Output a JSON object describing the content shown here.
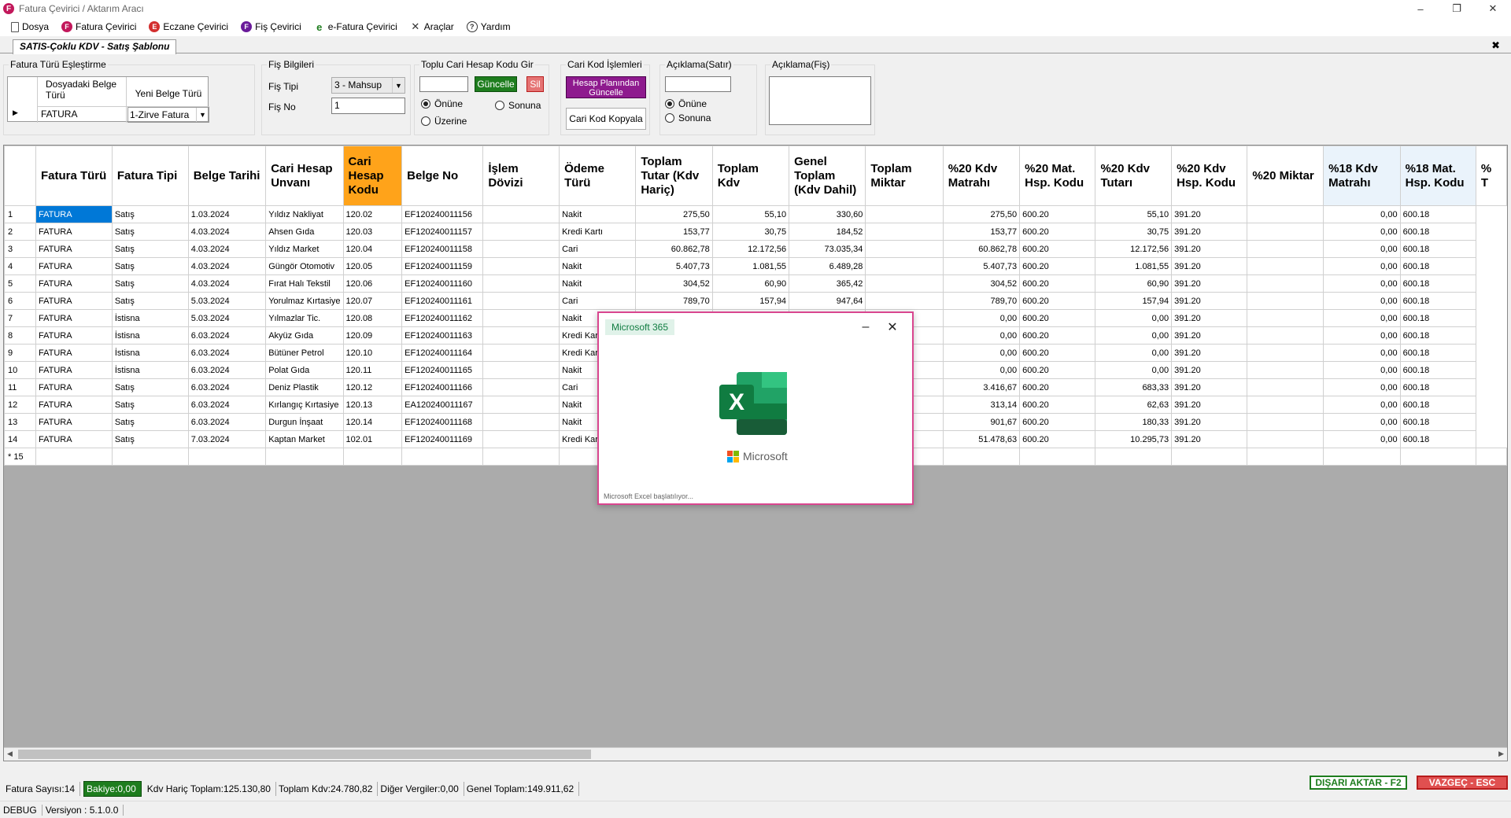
{
  "window": {
    "title": "Fatura Çevirici / Aktarım Aracı",
    "logo_letter": "F"
  },
  "menu": [
    {
      "label": "Dosya",
      "icon": "document-icon",
      "letter": ""
    },
    {
      "label": "Fatura Çevirici",
      "icon": "fatura-logo-icon",
      "letter": "F"
    },
    {
      "label": "Eczane Çevirici",
      "icon": "eczane-logo-icon",
      "letter": "E"
    },
    {
      "label": "Fiş Çevirici",
      "icon": "fis-logo-icon",
      "letter": "F"
    },
    {
      "label": "e-Fatura Çevirici",
      "icon": "efatura-icon",
      "letter": "e"
    },
    {
      "label": "Araçlar",
      "icon": "tools-icon",
      "letter": "✕"
    },
    {
      "label": "Yardım",
      "icon": "help-icon",
      "letter": "?"
    }
  ],
  "tab": {
    "label": "SATIS-Çoklu KDV - Satış Şablonu"
  },
  "fatura_turu": {
    "title": "Fatura Türü Eşleştirme",
    "col1": "Dosyadaki Belge Türü",
    "col2": "Yeni Belge Türü",
    "row_value": "FATURA",
    "new_type": "1-Zirve Fatura"
  },
  "fis_bilgileri": {
    "title": "Fiş Bilgileri",
    "fis_tipi_label": "Fiş Tipi",
    "fis_tipi_value": "3 - Mahsup",
    "fis_no_label": "Fiş No",
    "fis_no_value": "1"
  },
  "toplu_cari": {
    "title": "Toplu Cari Hesap Kodu Gir",
    "input_value": "",
    "update_label": "Güncelle",
    "delete_label": "Sil",
    "radio_onune": "Önüne",
    "radio_sonuna": "Sonuna",
    "radio_uzerine": "Üzerine"
  },
  "cari_kod": {
    "title": "Cari Kod İşlemleri",
    "update_plan_label": "Hesap Planından Güncelle",
    "copy_label": "Cari Kod Kopyala"
  },
  "aciklama_satir": {
    "title": "Açıklama(Satır)",
    "value": "",
    "radio_onune": "Önüne",
    "radio_sonuna": "Sonuna"
  },
  "aciklama_fis": {
    "title": "Açıklama(Fiş)",
    "value": ""
  },
  "grid": {
    "headers": [
      "Fatura Türü",
      "Fatura Tipi",
      "Belge Tarihi",
      "Cari Hesap Unvanı",
      "Cari Hesap Kodu",
      "Belge No",
      "İşlem Dövizi",
      "Ödeme Türü",
      "Toplam Tutar (Kdv Hariç)",
      "Toplam Kdv",
      "Genel Toplam (Kdv Dahil)",
      "Toplam Miktar",
      "%20 Kdv Matrahı",
      "%20 Mat. Hsp. Kodu",
      "%20 Kdv Tutarı",
      "%20 Kdv Hsp. Kodu",
      "%20 Miktar",
      "%18 Kdv Matrahı",
      "%18 Mat. Hsp. Kodu",
      "% T"
    ],
    "rows": [
      [
        "1",
        "FATURA",
        "Satış",
        "1.03.2024",
        "Yıldız Nakliyat",
        "120.02",
        "EF120240011156",
        "",
        "Nakit",
        "275,50",
        "55,10",
        "330,60",
        "",
        "275,50",
        "600.20",
        "55,10",
        "391.20",
        "",
        "0,00",
        "600.18"
      ],
      [
        "2",
        "FATURA",
        "Satış",
        "4.03.2024",
        "Ahsen Gıda",
        "120.03",
        "EF120240011157",
        "",
        "Kredi Kartı",
        "153,77",
        "30,75",
        "184,52",
        "",
        "153,77",
        "600.20",
        "30,75",
        "391.20",
        "",
        "0,00",
        "600.18"
      ],
      [
        "3",
        "FATURA",
        "Satış",
        "4.03.2024",
        "Yıldız Market",
        "120.04",
        "EF120240011158",
        "",
        "Cari",
        "60.862,78",
        "12.172,56",
        "73.035,34",
        "",
        "60.862,78",
        "600.20",
        "12.172,56",
        "391.20",
        "",
        "0,00",
        "600.18"
      ],
      [
        "4",
        "FATURA",
        "Satış",
        "4.03.2024",
        "Güngör Otomotiv",
        "120.05",
        "EF120240011159",
        "",
        "Nakit",
        "5.407,73",
        "1.081,55",
        "6.489,28",
        "",
        "5.407,73",
        "600.20",
        "1.081,55",
        "391.20",
        "",
        "0,00",
        "600.18"
      ],
      [
        "5",
        "FATURA",
        "Satış",
        "4.03.2024",
        "Fırat Halı Tekstil",
        "120.06",
        "EF120240011160",
        "",
        "Nakit",
        "304,52",
        "60,90",
        "365,42",
        "",
        "304,52",
        "600.20",
        "60,90",
        "391.20",
        "",
        "0,00",
        "600.18"
      ],
      [
        "6",
        "FATURA",
        "Satış",
        "5.03.2024",
        "Yorulmaz Kırtasiye",
        "120.07",
        "EF120240011161",
        "",
        "Cari",
        "789,70",
        "157,94",
        "947,64",
        "",
        "789,70",
        "600.20",
        "157,94",
        "391.20",
        "",
        "0,00",
        "600.18"
      ],
      [
        "7",
        "FATURA",
        "İstisna",
        "5.03.2024",
        "Yılmazlar Tic.",
        "120.08",
        "EF120240011162",
        "",
        "Nakit",
        "",
        "",
        "",
        "",
        "0,00",
        "600.20",
        "0,00",
        "391.20",
        "",
        "0,00",
        "600.18"
      ],
      [
        "8",
        "FATURA",
        "İstisna",
        "6.03.2024",
        "Akyüz Gıda",
        "120.09",
        "EF120240011163",
        "",
        "Kredi Kartı",
        "",
        "",
        "",
        "",
        "0,00",
        "600.20",
        "0,00",
        "391.20",
        "",
        "0,00",
        "600.18"
      ],
      [
        "9",
        "FATURA",
        "İstisna",
        "6.03.2024",
        "Bütüner Petrol",
        "120.10",
        "EF120240011164",
        "",
        "Kredi Kartı",
        "",
        "",
        "",
        "",
        "0,00",
        "600.20",
        "0,00",
        "391.20",
        "",
        "0,00",
        "600.18"
      ],
      [
        "10",
        "FATURA",
        "İstisna",
        "6.03.2024",
        "Polat Gıda",
        "120.11",
        "EF120240011165",
        "",
        "Nakit",
        "",
        "",
        "",
        "",
        "0,00",
        "600.20",
        "0,00",
        "391.20",
        "",
        "0,00",
        "600.18"
      ],
      [
        "11",
        "FATURA",
        "Satış",
        "6.03.2024",
        "Deniz Plastik",
        "120.12",
        "EF120240011166",
        "",
        "Cari",
        "",
        "",
        "",
        "",
        "3.416,67",
        "600.20",
        "683,33",
        "391.20",
        "",
        "0,00",
        "600.18"
      ],
      [
        "12",
        "FATURA",
        "Satış",
        "6.03.2024",
        "Kırlangıç Kırtasiye",
        "120.13",
        "EA120240011167",
        "",
        "Nakit",
        "",
        "",
        "",
        "",
        "313,14",
        "600.20",
        "62,63",
        "391.20",
        "",
        "0,00",
        "600.18"
      ],
      [
        "13",
        "FATURA",
        "Satış",
        "6.03.2024",
        "Durgun İnşaat",
        "120.14",
        "EF120240011168",
        "",
        "Nakit",
        "",
        "",
        "",
        "",
        "901,67",
        "600.20",
        "180,33",
        "391.20",
        "",
        "0,00",
        "600.18"
      ],
      [
        "14",
        "FATURA",
        "Satış",
        "7.03.2024",
        "Kaptan Market",
        "102.01",
        "EF120240011169",
        "",
        "Kredi Kartı",
        "",
        "",
        "",
        "",
        "51.478,63",
        "600.20",
        "10.295,73",
        "391.20",
        "",
        "0,00",
        "600.18"
      ]
    ],
    "new_row_label": "* 15"
  },
  "status": {
    "fatura_sayisi": "Fatura Sayısı:14",
    "bakiye": "Bakiye:0,00",
    "kdv_haric": "Kdv Hariç Toplam:125.130,80",
    "toplam_kdv": "Toplam Kdv:24.780,82",
    "diger": "Diğer Vergiler:0,00",
    "genel": "Genel Toplam:149.911,62"
  },
  "actions": {
    "export": "DIŞARI AKTAR - F2",
    "cancel": "VAZGEÇ - ESC"
  },
  "footer": {
    "mode": "DEBUG",
    "version": "Versiyon : 5.1.0.0"
  },
  "splash": {
    "badge": "Microsoft 365",
    "brand": "Microsoft",
    "starting": "Microsoft Excel başlatılıyor..."
  },
  "colors": {
    "accent_orange": "#ffa31a",
    "green": "#1e7d1e",
    "purple": "#8e1a8e",
    "excel": "#107c41"
  }
}
